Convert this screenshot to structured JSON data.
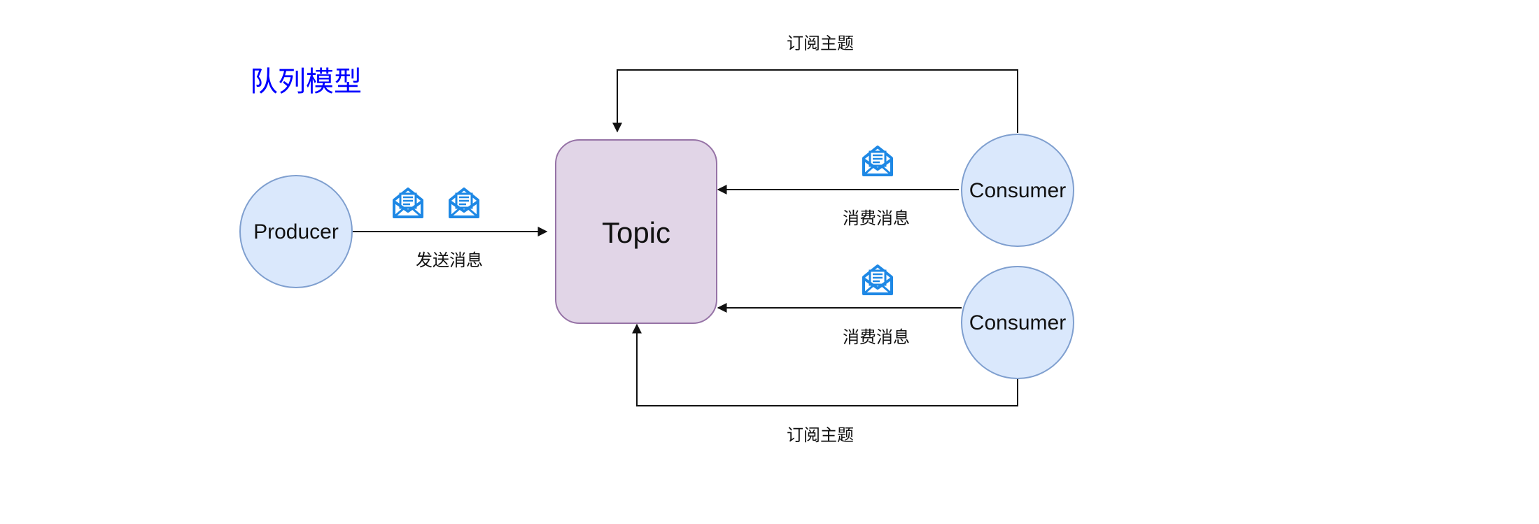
{
  "title": "队列模型",
  "colors": {
    "title": "#0000ff",
    "circle_fill": "#dae8fc",
    "circle_stroke": "#7f9fcf",
    "topic_fill": "#e1d5e7",
    "topic_stroke": "#9673a6",
    "icon": "#1e88e5",
    "line": "#111111"
  },
  "nodes": {
    "producer": "Producer",
    "topic": "Topic",
    "consumer_1": "Consumer",
    "consumer_2": "Consumer"
  },
  "edges": {
    "send": "发送消息",
    "consume_1": "消费消息",
    "consume_2": "消费消息",
    "subscribe_1": "订阅主题",
    "subscribe_2": "订阅主题"
  },
  "icons": [
    "envelope-icon",
    "envelope-icon",
    "envelope-icon",
    "envelope-icon"
  ]
}
